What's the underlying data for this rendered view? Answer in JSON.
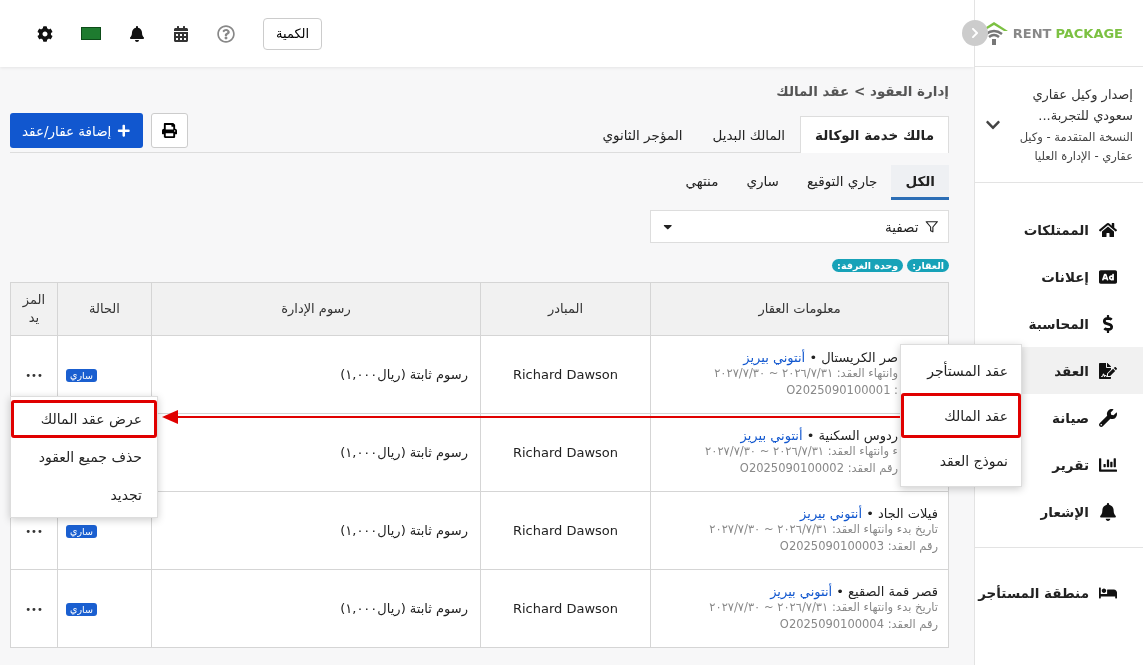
{
  "logo": {
    "word_1": "RENT",
    "word_2": "PACKAGE"
  },
  "company": {
    "name": "إصدار وكيل عقاري سعودي للتجربة...",
    "plan": "النسخة المتقدمة - وكيل عقاري - الإدارة العليا"
  },
  "sidebar": {
    "items": [
      {
        "label": "الممتلكات",
        "selected": false
      },
      {
        "label": "إعلانات",
        "selected": false
      },
      {
        "label": "المحاسبة",
        "selected": false
      },
      {
        "label": "العقد",
        "selected": true
      },
      {
        "label": "صيانة",
        "selected": false
      },
      {
        "label": "تقرير",
        "selected": false
      },
      {
        "label": "الإشعار",
        "selected": false
      }
    ],
    "footer_item": {
      "label": "منطقة المستأجر"
    }
  },
  "toolbar": {
    "quantity_button": "الكمية"
  },
  "breadcrumb": "إدارة العقود > عقد المالك",
  "tabs": [
    {
      "label": "مالك خدمة الوكالة",
      "selected": true
    },
    {
      "label": "المالك البديل",
      "selected": false
    },
    {
      "label": "المؤجر الثانوي",
      "selected": false
    }
  ],
  "add_button": "إضافة عقار/عقد",
  "subtabs": [
    {
      "label": "الكل",
      "selected": true
    },
    {
      "label": "جاري التوقيع",
      "selected": false
    },
    {
      "label": "ساري",
      "selected": false
    },
    {
      "label": "منتهي",
      "selected": false
    }
  ],
  "filter": {
    "placeholder": "تصفية"
  },
  "tags": [
    "العقار:",
    "وحدة الغرفة:"
  ],
  "table": {
    "columns": [
      "معلومات العقار",
      "المبادر",
      "رسوم الإدارة",
      "الحالة",
      "المز يد"
    ],
    "rows": [
      {
        "property": "صر الكريستال •",
        "owner": "أنتوني بيريز",
        "dates": "وانتهاء العقد: ٢٠٢٦/٧/٣١ ~ ٢٠٢٧/٧/٣٠",
        "contract_no": ": O2025090100001",
        "partly_hidden": true,
        "initiator": "Richard Dawson",
        "fee": "رسوم ثابتة (ريال١,٠٠٠)",
        "status": "ساري",
        "more": "•••"
      },
      {
        "property": "ردوس السكنية •",
        "owner": "أنتوني بيريز",
        "dates": "ء وانتهاء العقد: ٢٠٢٦/٧/٣١ ~ ٢٠٢٧/٧/٣٠",
        "contract_no": "رقم العقد: O2025090100002",
        "partly_hidden": true,
        "initiator": "Richard Dawson",
        "fee": "رسوم ثابتة (ريال١,٠٠٠)"
      },
      {
        "property": "فيلات الجاد •",
        "owner": "أنتوني بيريز",
        "dates": "تاريخ بدء وانتهاء العقد: ٢٠٢٦/٧/٣١ ~ ٢٠٢٧/٧/٣٠",
        "contract_no": "رقم العقد: O2025090100003",
        "partly_hidden": false,
        "initiator": "Richard Dawson",
        "fee": "رسوم ثابتة (ريال١,٠٠٠)",
        "status": "ساري",
        "more": "•••"
      },
      {
        "property": "قصر قمة الصقيع •",
        "owner": "أنتوني بيريز",
        "dates": "تاريخ بدء وانتهاء العقد: ٢٠٢٦/٧/٣١ ~ ٢٠٢٧/٧/٣٠",
        "contract_no": "رقم العقد: O2025090100004",
        "partly_hidden": false,
        "initiator": "Richard Dawson",
        "fee": "رسوم ثابتة (ريال١,٠٠٠)",
        "status": "ساري",
        "more": "•••"
      }
    ]
  },
  "submenu": [
    {
      "label": "عقد المستأجر",
      "highlighted": false
    },
    {
      "label": "عقد المالك",
      "highlighted": true
    },
    {
      "label": "نموذج العقد",
      "highlighted": false
    }
  ],
  "row_menu": [
    {
      "label": "عرض عقد المالك",
      "highlighted": true
    },
    {
      "label": "حذف جميع العقود",
      "highlighted": false
    },
    {
      "label": "تجديد",
      "highlighted": false
    }
  ]
}
